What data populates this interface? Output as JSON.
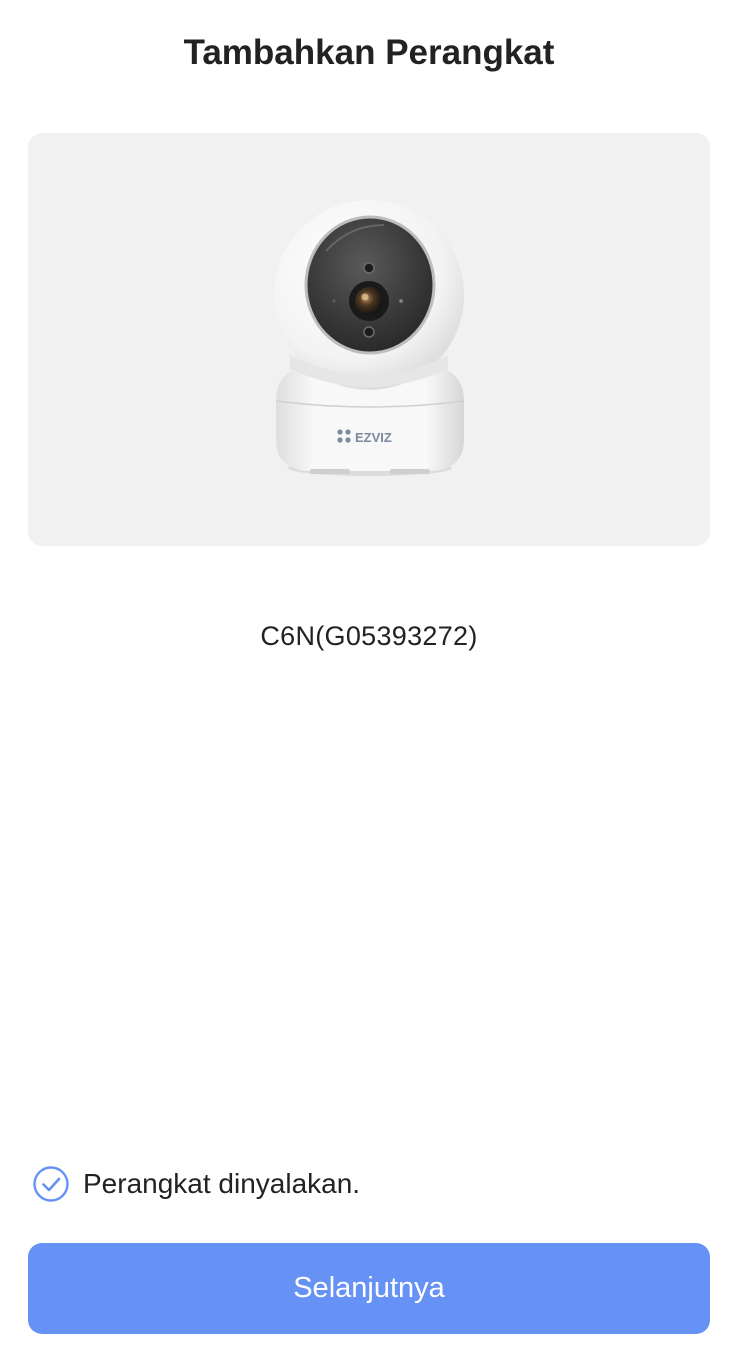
{
  "header": {
    "title": "Tambahkan Perangkat"
  },
  "device": {
    "image_icon": "ezviz-pan-tilt-camera",
    "brand_logo_text": "EZVIZ",
    "name": "C6N(G05393272)"
  },
  "confirmation": {
    "checked": true,
    "icon": "check-circle-icon",
    "label": "Perangkat dinyalakan."
  },
  "footer": {
    "next_label": "Selanjutnya"
  },
  "colors": {
    "accent": "#6691f5",
    "panel_background": "#f1f1f1",
    "title_text": "#222222"
  }
}
